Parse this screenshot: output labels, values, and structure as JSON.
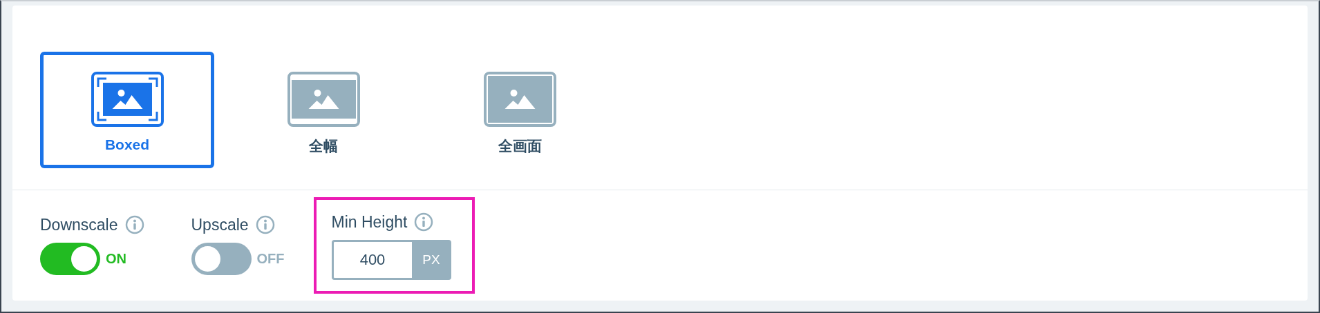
{
  "layout_options": [
    {
      "label": "Boxed",
      "kind": "boxed",
      "selected": true
    },
    {
      "label": "全幅",
      "kind": "full-width",
      "selected": false
    },
    {
      "label": "全画面",
      "kind": "fullscreen",
      "selected": false
    }
  ],
  "settings": [
    {
      "kind": "toggle",
      "label": "Downscale",
      "on": true,
      "state_text": "ON"
    },
    {
      "kind": "toggle",
      "label": "Upscale",
      "on": false,
      "state_text": "OFF"
    },
    {
      "kind": "number",
      "label": "Min Height",
      "value": "400",
      "unit": "PX",
      "highlighted": true
    }
  ]
}
